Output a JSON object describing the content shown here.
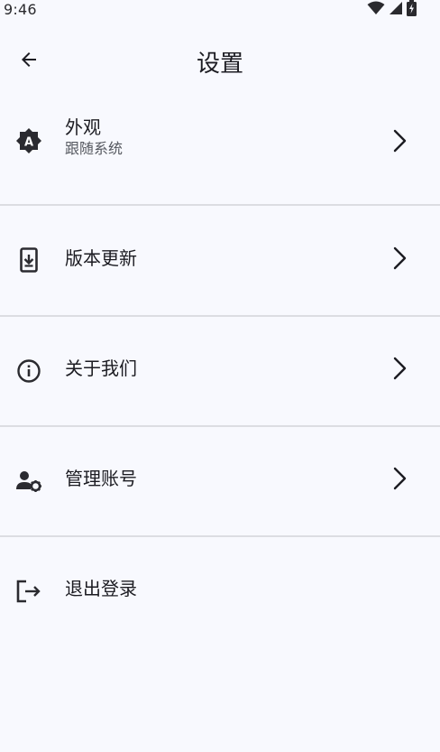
{
  "status_bar": {
    "time": "9:46"
  },
  "header": {
    "title": "设置",
    "back_icon": "arrow-left-icon"
  },
  "settings": {
    "items": [
      {
        "label": "外观",
        "sublabel": "跟随系统",
        "icon": "appearance-icon",
        "has_chevron": true
      },
      {
        "label": "版本更新",
        "icon": "download-icon",
        "has_chevron": true
      },
      {
        "label": "关于我们",
        "icon": "info-icon",
        "has_chevron": true
      },
      {
        "label": "管理账号",
        "icon": "manage-account-icon",
        "has_chevron": true
      },
      {
        "label": "退出登录",
        "icon": "logout-icon",
        "has_chevron": false
      }
    ]
  },
  "colors": {
    "background": "#f8f9fe",
    "text": "#1c1c22",
    "subtext": "#55585f",
    "divider": "#dcdde2"
  }
}
